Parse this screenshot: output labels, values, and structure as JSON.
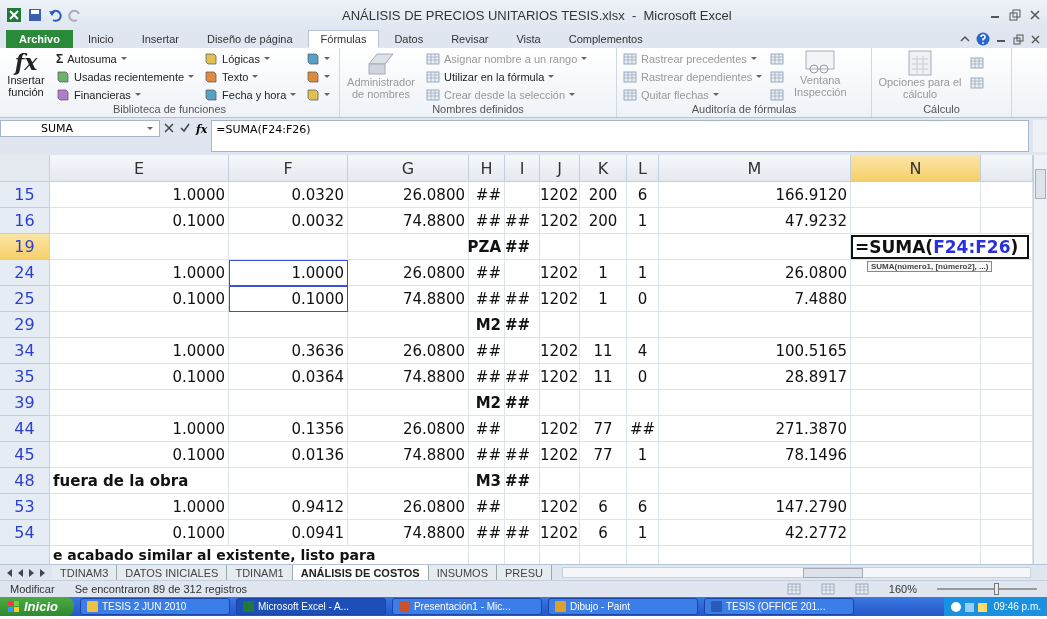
{
  "window": {
    "title": "ANÁLISIS DE PRECIOS UNITARIOS TESIS.xlsx  -  Microsoft Excel"
  },
  "ribbon_tabs": [
    {
      "label": "Archivo",
      "kind": "file",
      "selected": false
    },
    {
      "label": "Inicio",
      "kind": "tab",
      "selected": false
    },
    {
      "label": "Insertar",
      "kind": "tab",
      "selected": false
    },
    {
      "label": "Diseño de página",
      "kind": "tab",
      "selected": false
    },
    {
      "label": "Fórmulas",
      "kind": "tab",
      "selected": true
    },
    {
      "label": "Datos",
      "kind": "tab",
      "selected": false
    },
    {
      "label": "Revisar",
      "kind": "tab",
      "selected": false
    },
    {
      "label": "Vista",
      "kind": "tab",
      "selected": false
    },
    {
      "label": "Complementos",
      "kind": "tab",
      "selected": false
    }
  ],
  "ribbon": {
    "insert_function": {
      "symbol": "fx",
      "label": "Insertar función"
    },
    "function_library": {
      "title": "Biblioteca de funciones",
      "commands": [
        {
          "label": "Autosuma",
          "symbol": "Σ"
        },
        {
          "label": "Usadas recientemente"
        },
        {
          "label": "Financieras"
        },
        {
          "label": "Lógicas"
        },
        {
          "label": "Texto"
        },
        {
          "label": "Fecha y hora"
        }
      ]
    },
    "defined_names": {
      "title": "Nombres definidos",
      "manager": {
        "label": "Administrador de nombres",
        "disabled": true
      },
      "commands": [
        {
          "label": "Asignar nombre a un rango",
          "disabled": true
        },
        {
          "label": "Utilizar en la fórmula",
          "disabled": false
        },
        {
          "label": "Crear desde la selección",
          "disabled": true
        }
      ]
    },
    "formula_auditing": {
      "title": "Auditoría de fórmulas",
      "commands": [
        {
          "label": "Rastrear precedentes",
          "disabled": true
        },
        {
          "label": "Rastrear dependientes",
          "disabled": true
        },
        {
          "label": "Quitar flechas",
          "disabled": true
        }
      ],
      "watch_window": {
        "label": "Ventana Inspección",
        "disabled": true
      }
    },
    "calculation": {
      "title": "Cálculo",
      "options": {
        "label": "Opciones para el cálculo",
        "disabled": true
      }
    }
  },
  "formula_bar": {
    "name_box": "SUMA",
    "fx": "fx",
    "formula": "=SUMA(F24:F26)"
  },
  "grid": {
    "columns": [
      {
        "label": "E",
        "selected": false,
        "in_range": false
      },
      {
        "label": "F",
        "selected": false,
        "in_range": true
      },
      {
        "label": "G",
        "selected": false,
        "in_range": false
      },
      {
        "label": "H",
        "selected": false,
        "in_range": false
      },
      {
        "label": "I",
        "selected": false,
        "in_range": false
      },
      {
        "label": "J",
        "selected": false,
        "in_range": false
      },
      {
        "label": "K",
        "selected": false,
        "in_range": false
      },
      {
        "label": "L",
        "selected": false,
        "in_range": false
      },
      {
        "label": "M",
        "selected": false,
        "in_range": false
      },
      {
        "label": "N",
        "selected": true,
        "in_range": false
      }
    ],
    "rows": [
      {
        "number": "15",
        "kind": "item",
        "selected": false,
        "in_selection": false,
        "cells": [
          "1.0000",
          "0.0320",
          "26.0800",
          "##",
          null,
          "1202",
          "200",
          "6",
          "166.9120",
          null
        ]
      },
      {
        "number": "16",
        "kind": "item",
        "selected": false,
        "in_selection": false,
        "cells": [
          "0.1000",
          "0.0032",
          "74.8800",
          "##",
          "##",
          "1202",
          "200",
          "1",
          "47.9232",
          null
        ]
      },
      {
        "number": "19",
        "kind": "section",
        "selected": true,
        "in_selection": false,
        "cells": [
          null,
          null,
          null,
          "PZA",
          "##",
          null,
          null,
          null,
          null,
          null
        ]
      },
      {
        "number": "24",
        "kind": "item",
        "selected": false,
        "in_selection": true,
        "cells": [
          "1.0000",
          "1.0000",
          "26.0800",
          "##",
          null,
          "1202",
          "1",
          "1",
          "26.0800",
          null
        ]
      },
      {
        "number": "25",
        "kind": "item",
        "selected": false,
        "in_selection": true,
        "cells": [
          "0.1000",
          "0.1000",
          "74.8800",
          "##",
          "##",
          "1202",
          "1",
          "0",
          "7.4880",
          null
        ]
      },
      {
        "number": "29",
        "kind": "section",
        "selected": false,
        "in_selection": false,
        "cells": [
          null,
          null,
          null,
          "M2",
          "##",
          null,
          null,
          null,
          null,
          null
        ]
      },
      {
        "number": "34",
        "kind": "item",
        "selected": false,
        "in_selection": false,
        "cells": [
          "1.0000",
          "0.3636",
          "26.0800",
          "##",
          null,
          "1202",
          "11",
          "4",
          "100.5165",
          null
        ]
      },
      {
        "number": "35",
        "kind": "item",
        "selected": false,
        "in_selection": false,
        "cells": [
          "0.1000",
          "0.0364",
          "74.8800",
          "##",
          "##",
          "1202",
          "11",
          "0",
          "28.8917",
          null
        ]
      },
      {
        "number": "39",
        "kind": "section",
        "selected": false,
        "in_selection": false,
        "cells": [
          null,
          null,
          null,
          "M2",
          "##",
          null,
          null,
          null,
          null,
          null
        ]
      },
      {
        "number": "44",
        "kind": "item",
        "selected": false,
        "in_selection": false,
        "cells": [
          "1.0000",
          "0.1356",
          "26.0800",
          "##",
          null,
          "1202",
          "77",
          "##",
          "271.3870",
          null
        ]
      },
      {
        "number": "45",
        "kind": "item",
        "selected": false,
        "in_selection": false,
        "cells": [
          "0.1000",
          "0.0136",
          "74.8800",
          "##",
          "##",
          "1202",
          "77",
          "1",
          "78.1496",
          null
        ]
      },
      {
        "number": "48",
        "kind": "section",
        "selected": false,
        "in_selection": false,
        "cells": [
          "fuera de la obra",
          null,
          null,
          "M3",
          "##",
          null,
          null,
          null,
          null,
          null
        ]
      },
      {
        "number": "53",
        "kind": "item",
        "selected": false,
        "in_selection": false,
        "cells": [
          "1.0000",
          "0.9412",
          "26.0800",
          "##",
          null,
          "1202",
          "6",
          "6",
          "147.2790",
          null
        ]
      },
      {
        "number": "54",
        "kind": "item",
        "selected": false,
        "in_selection": false,
        "cells": [
          "0.1000",
          "0.0941",
          "74.8800",
          "##",
          "##",
          "1202",
          "6",
          "1",
          "42.2772",
          null
        ]
      },
      {
        "kind": "section",
        "selected": false,
        "in_selection": false,
        "cells": [
          "e acabado similar al existente, listo para",
          null,
          null,
          null,
          null,
          null,
          null,
          null,
          null,
          null
        ]
      }
    ],
    "cell_editor": {
      "prefix": "=SUMA(",
      "reference": "F24:F26",
      "suffix": ")",
      "tooltip": "**SUMA**(número1, [número2], ...)"
    }
  },
  "sheet_tabs": [
    {
      "label": "TDINAM3",
      "selected": false
    },
    {
      "label": "DATOS INICIALES",
      "selected": false
    },
    {
      "label": "TDINAM1",
      "selected": false
    },
    {
      "label": "ANÁLISIS DE COSTOS",
      "selected": true
    },
    {
      "label": "INSUMOS",
      "selected": false
    },
    {
      "label": "PRESU",
      "selected": false
    }
  ],
  "status_bar": {
    "mode": "Modificar",
    "message": "Se encontraron 89 de 312 registros",
    "zoom": {
      "label": "160%",
      "level": 0.6
    }
  },
  "taskbar": {
    "start": "Inicio",
    "items": [
      {
        "label": "TESIS 2 JUN 2010",
        "selected": false
      },
      {
        "label": "Microsoft Excel - A...",
        "selected": true
      },
      {
        "label": "Presentación1 - Mic...",
        "selected": false
      },
      {
        "label": "Dibujo - Paint",
        "selected": false
      },
      {
        "label": "TESIS (OFFICE 201...",
        "selected": false
      }
    ],
    "clock": "09:46 p.m."
  }
}
